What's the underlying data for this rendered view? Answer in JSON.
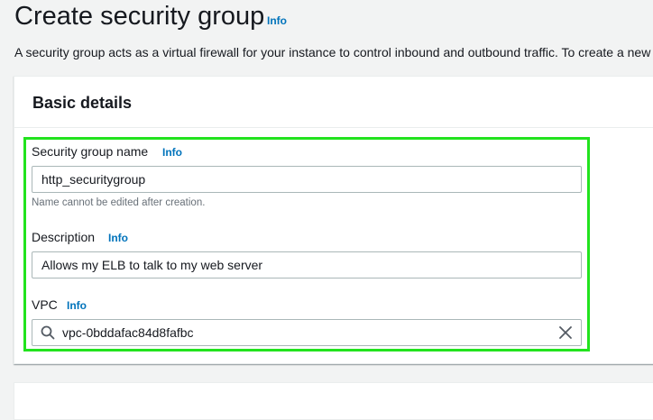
{
  "header": {
    "title": "Create security group",
    "info_label": "Info",
    "description": "A security group acts as a virtual firewall for your instance to control inbound and outbound traffic. To create a new security group, complete the fields below."
  },
  "basic_details": {
    "heading": "Basic details",
    "name_field": {
      "label": "Security group name",
      "info_label": "Info",
      "value": "http_securitygroup",
      "hint": "Name cannot be edited after creation."
    },
    "description_field": {
      "label": "Description",
      "info_label": "Info",
      "value": "Allows my ELB to talk to my web server"
    },
    "vpc_field": {
      "label": "VPC",
      "info_label": "Info",
      "value": "vpc-0bddafac84d8fafbc"
    }
  },
  "colors": {
    "highlight_border": "#22e31e",
    "link": "#0073bb"
  }
}
